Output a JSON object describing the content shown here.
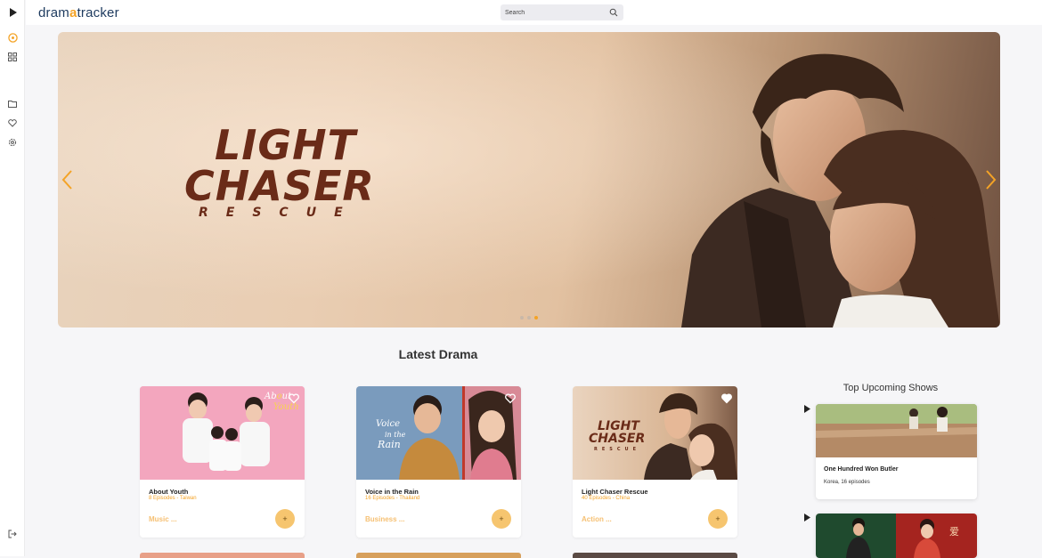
{
  "app": {
    "logo_prefix": "dram",
    "logo_accent": "a",
    "logo_suffix": "tracker"
  },
  "search": {
    "placeholder": "Search"
  },
  "rail": {
    "icons": [
      "play-icon",
      "discover-icon",
      "grid-icon",
      "folder-icon",
      "heart-icon",
      "settings-icon",
      "logout-icon"
    ]
  },
  "hero": {
    "title_line1": "LIGHT",
    "title_line2": "CHASER",
    "title_line3": "RESCUE",
    "active_slide": 3,
    "slide_count": 3
  },
  "latest": {
    "heading": "Latest Drama",
    "items": [
      {
        "title": "About Youth",
        "meta": "8 Episodes - Taiwan",
        "genre": "Music ...",
        "add": "+"
      },
      {
        "title": "Voice in the Rain",
        "meta": "16 Episodes - Thailand",
        "genre": "Business ...",
        "add": "+"
      },
      {
        "title": "Light Chaser Rescue",
        "meta": "40 Episodes - China",
        "genre": "Action ...",
        "add": "+"
      }
    ]
  },
  "upcoming": {
    "heading": "Top Upcoming Shows",
    "items": [
      {
        "title": "One Hundred Won Butler",
        "meta": "Korea, 16 episodes"
      },
      {
        "title": "",
        "meta": ""
      }
    ]
  },
  "colors": {
    "accent": "#f4a326",
    "brand": "#1d3a5e"
  }
}
